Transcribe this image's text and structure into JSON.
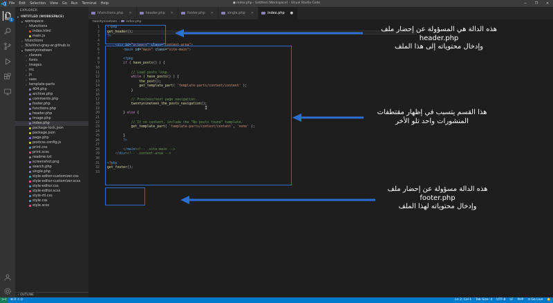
{
  "titlebar": {
    "menu": [
      "File",
      "Edit",
      "Selection",
      "View",
      "Go",
      "Run",
      "Terminal",
      "Help"
    ],
    "title": "● index.php - Untitled (Workspace) - Visual Studio Code",
    "controls": [
      "─",
      "❐",
      "✕"
    ]
  },
  "activitybar": {
    "icons": [
      "explorer-icon",
      "search-icon",
      "source-control-icon",
      "run-debug-icon",
      "extensions-icon",
      "remote-explorer-icon",
      "account-icon",
      "settings-gear-icon"
    ],
    "explorer_badge": "1"
  },
  "sidebar": {
    "title": "EXPLORER",
    "rows": [
      {
        "label": "UNTITLED (WORKSPACE)",
        "indent": 0,
        "chev": "▾",
        "bold": true,
        "icon": ""
      },
      {
        "label": "workspace",
        "indent": 1,
        "chev": "▾",
        "icon": ""
      },
      {
        "label": "hfunctions",
        "indent": 2,
        "chev": "›",
        "icon": ""
      },
      {
        "label": "index.html",
        "indent": 2,
        "chev": "",
        "icon": "#e44d26"
      },
      {
        "label": "main.js",
        "indent": 2,
        "chev": "",
        "icon": "#cbcb41"
      },
      {
        "label": "hfunctions",
        "indent": 1,
        "chev": "›",
        "icon": ""
      },
      {
        "label": "3DaVinci-gray-ar.github.io",
        "indent": 1,
        "chev": "›",
        "icon": ""
      },
      {
        "label": "twentynineteen",
        "indent": 1,
        "chev": "▾",
        "icon": ""
      },
      {
        "label": "classes",
        "indent": 2,
        "chev": "›",
        "icon": ""
      },
      {
        "label": "fonts",
        "indent": 2,
        "chev": "›",
        "icon": ""
      },
      {
        "label": "images",
        "indent": 2,
        "chev": "›",
        "icon": ""
      },
      {
        "label": "inc",
        "indent": 2,
        "chev": "›",
        "icon": ""
      },
      {
        "label": "js",
        "indent": 2,
        "chev": "›",
        "icon": ""
      },
      {
        "label": "sass",
        "indent": 2,
        "chev": "›",
        "icon": ""
      },
      {
        "label": "template-parts",
        "indent": 2,
        "chev": "›",
        "icon": ""
      },
      {
        "label": "404.php",
        "indent": 2,
        "chev": "",
        "icon": "#8a7fb8"
      },
      {
        "label": "archive.php",
        "indent": 2,
        "chev": "",
        "icon": "#8a7fb8"
      },
      {
        "label": "comments.php",
        "indent": 2,
        "chev": "",
        "icon": "#8a7fb8"
      },
      {
        "label": "footer.php",
        "indent": 2,
        "chev": "",
        "icon": "#8a7fb8"
      },
      {
        "label": "functions.php",
        "indent": 2,
        "chev": "",
        "icon": "#8a7fb8"
      },
      {
        "label": "header.php",
        "indent": 2,
        "chev": "",
        "icon": "#8a7fb8"
      },
      {
        "label": "image.php",
        "indent": 2,
        "chev": "",
        "icon": "#8a7fb8"
      },
      {
        "label": "index.php",
        "indent": 2,
        "chev": "",
        "icon": "#8a7fb8",
        "selected": true
      },
      {
        "label": "package-lock.json",
        "indent": 2,
        "chev": "",
        "icon": "#cbcb41"
      },
      {
        "label": "package.json",
        "indent": 2,
        "chev": "",
        "icon": "#cbcb41"
      },
      {
        "label": "page.php",
        "indent": 2,
        "chev": "",
        "icon": "#8a7fb8"
      },
      {
        "label": "postcss.config.js",
        "indent": 2,
        "chev": "",
        "icon": "#cbcb41"
      },
      {
        "label": "print.css",
        "indent": 2,
        "chev": "",
        "icon": "#519aba"
      },
      {
        "label": "print.scss",
        "indent": 2,
        "chev": "",
        "icon": "#f55385"
      },
      {
        "label": "readme.txt",
        "indent": 2,
        "chev": "",
        "icon": "#888888"
      },
      {
        "label": "screenshot.png",
        "indent": 2,
        "chev": "",
        "icon": "#a074c4"
      },
      {
        "label": "search.php",
        "indent": 2,
        "chev": "",
        "icon": "#8a7fb8"
      },
      {
        "label": "single.php",
        "indent": 2,
        "chev": "",
        "icon": "#8a7fb8"
      },
      {
        "label": "style-editor-customizer.css",
        "indent": 2,
        "chev": "",
        "icon": "#519aba"
      },
      {
        "label": "style-editor-customizer.scss",
        "indent": 2,
        "chev": "",
        "icon": "#f55385"
      },
      {
        "label": "style-editor.css",
        "indent": 2,
        "chev": "",
        "icon": "#519aba"
      },
      {
        "label": "style-editor.scss",
        "indent": 2,
        "chev": "",
        "icon": "#f55385"
      },
      {
        "label": "style-rtl.css",
        "indent": 2,
        "chev": "",
        "icon": "#519aba"
      },
      {
        "label": "style.css",
        "indent": 2,
        "chev": "",
        "icon": "#519aba"
      },
      {
        "label": "style.scss",
        "indent": 2,
        "chev": "",
        "icon": "#f55385"
      }
    ],
    "outline_label": "OUTLINE"
  },
  "tabs": [
    {
      "label": "hfunctions.php",
      "active": false
    },
    {
      "label": "header.php",
      "active": false
    },
    {
      "label": "footer.php",
      "active": false
    },
    {
      "label": "single.php",
      "active": false
    },
    {
      "label": "index.php",
      "active": true
    }
  ],
  "breadcrumb": [
    "twentynineteen",
    "index.php"
  ],
  "editor": {
    "cursor_line": 2,
    "lines": [
      [
        [
          "t-php",
          "<?php"
        ]
      ],
      [
        [
          "t-fn",
          "get_header"
        ],
        [
          "",
          "();"
        ]
      ],
      [
        [
          "t-php",
          "?>"
        ]
      ],
      [
        [
          "",
          ""
        ]
      ],
      [
        [
          "",
          "\t"
        ],
        [
          "t-punc",
          "<"
        ],
        [
          "t-tag",
          "div"
        ],
        [
          "",
          " "
        ],
        [
          "t-attr",
          "id"
        ],
        [
          "",
          "="
        ],
        [
          "t-str",
          "\"primary\""
        ],
        [
          "",
          " "
        ],
        [
          "t-attr",
          "class"
        ],
        [
          "",
          "="
        ],
        [
          "t-str",
          "\"content-area\""
        ],
        [
          "t-punc",
          ">"
        ]
      ],
      [
        [
          "",
          "\t\t"
        ],
        [
          "t-punc",
          "<"
        ],
        [
          "t-tag",
          "main"
        ],
        [
          "",
          " "
        ],
        [
          "t-attr",
          "id"
        ],
        [
          "",
          "="
        ],
        [
          "t-str",
          "\"main\""
        ],
        [
          "",
          " "
        ],
        [
          "t-attr",
          "class"
        ],
        [
          "",
          "="
        ],
        [
          "t-str",
          "\"site-main\""
        ],
        [
          "t-punc",
          ">"
        ]
      ],
      [
        [
          "",
          ""
        ]
      ],
      [
        [
          "",
          "\t\t"
        ],
        [
          "t-php",
          "<?php"
        ]
      ],
      [
        [
          "",
          "\t\t"
        ],
        [
          "t-kw",
          "if"
        ],
        [
          "",
          " ( "
        ],
        [
          "t-fn",
          "have_posts"
        ],
        [
          "",
          "() ) {"
        ]
      ],
      [
        [
          "",
          ""
        ]
      ],
      [
        [
          "",
          "\t\t\t"
        ],
        [
          "t-com",
          "// Load posts loop."
        ]
      ],
      [
        [
          "",
          "\t\t\t"
        ],
        [
          "t-kw",
          "while"
        ],
        [
          "",
          " ( "
        ],
        [
          "t-fn",
          "have_posts"
        ],
        [
          "",
          "() ) {"
        ]
      ],
      [
        [
          "",
          "\t\t\t\t"
        ],
        [
          "t-fn",
          "the_post"
        ],
        [
          "",
          "();"
        ]
      ],
      [
        [
          "",
          "\t\t\t\t"
        ],
        [
          "t-fn",
          "get_template_part"
        ],
        [
          "",
          "( "
        ],
        [
          "t-str",
          "'template-parts/content/content'"
        ],
        [
          "",
          " );"
        ]
      ],
      [
        [
          "",
          "\t\t\t}"
        ]
      ],
      [
        [
          "",
          ""
        ]
      ],
      [
        [
          "",
          "\t\t\t"
        ],
        [
          "t-com",
          "// Previous/next page navigation."
        ]
      ],
      [
        [
          "",
          "\t\t\t"
        ],
        [
          "t-fn",
          "twentynineteen_the_posts_navigation"
        ],
        [
          "",
          "();"
        ]
      ],
      [
        [
          "",
          ""
        ]
      ],
      [
        [
          "",
          "\t\t} "
        ],
        [
          "t-kw",
          "else"
        ],
        [
          "",
          " {"
        ]
      ],
      [
        [
          "",
          ""
        ]
      ],
      [
        [
          "",
          "\t\t\t"
        ],
        [
          "t-com",
          "// If no content, include the \"No posts found\" template."
        ]
      ],
      [
        [
          "",
          "\t\t\t"
        ],
        [
          "t-fn",
          "get_template_part"
        ],
        [
          "",
          "( "
        ],
        [
          "t-str",
          "'template-parts/content/content'"
        ],
        [
          "",
          ", "
        ],
        [
          "t-str",
          "'none'"
        ],
        [
          "",
          " );"
        ]
      ],
      [
        [
          "",
          ""
        ]
      ],
      [
        [
          "",
          "\t\t}"
        ]
      ],
      [
        [
          "",
          "\t\t"
        ],
        [
          "t-php",
          "?>"
        ]
      ],
      [
        [
          "",
          ""
        ]
      ],
      [
        [
          "",
          "\t\t"
        ],
        [
          "t-punc",
          "</"
        ],
        [
          "t-tag",
          "main"
        ],
        [
          "t-punc",
          ">"
        ],
        [
          "t-com",
          "<!-- .site-main -->"
        ]
      ],
      [
        [
          "",
          "\t"
        ],
        [
          "t-punc",
          "</"
        ],
        [
          "t-tag",
          "div"
        ],
        [
          "t-punc",
          ">"
        ],
        [
          "t-com",
          "<!-- .content-area -->"
        ]
      ],
      [
        [
          "",
          ""
        ]
      ],
      [
        [
          "t-php",
          "<?php"
        ]
      ],
      [
        [
          "t-fn",
          "get_footer"
        ],
        [
          "",
          "();"
        ]
      ],
      [
        [
          "",
          ""
        ]
      ]
    ]
  },
  "annotations": {
    "header_note": [
      "هذه الدالة هي المسؤولة عن إحضار ملف",
      "header.php",
      "وإدخال محتوياته إلى هذا الملف"
    ],
    "loop_note": [
      "هذا القسم يتسبب في إظهار مقتطفات",
      "المنشورات واحد تلو الأخر"
    ],
    "footer_note": [
      "هذه الدالة مسؤولة عن إحضار ملف",
      "footer.php",
      "وإدخال محتوياته لهذا الملف"
    ],
    "box_color": "#2c6fd1"
  },
  "statusbar": {
    "remote": "><",
    "left": [
      "⊗ 0 ⚠ 0"
    ],
    "right": [
      "Ln 2, Col 1",
      "Tab Size: 4",
      "UTF-8",
      "LF",
      "PHP",
      "⊙ Go Live",
      "🔔"
    ]
  }
}
